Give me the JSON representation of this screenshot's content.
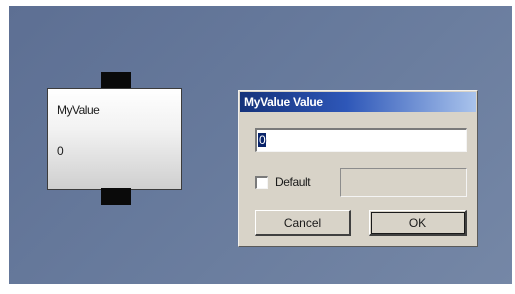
{
  "node": {
    "title": "MyValue",
    "value": "0"
  },
  "dialog": {
    "title": "MyValue Value",
    "input_value": "0",
    "default_checked": false,
    "default_label": "Default",
    "default_value": "",
    "cancel_label": "Cancel",
    "ok_label": "OK"
  },
  "colors": {
    "canvas": "#677a9c",
    "titlebar_start": "#15327a",
    "titlebar_end": "#a9c3ec",
    "dialog_face": "#d8d3c8"
  }
}
